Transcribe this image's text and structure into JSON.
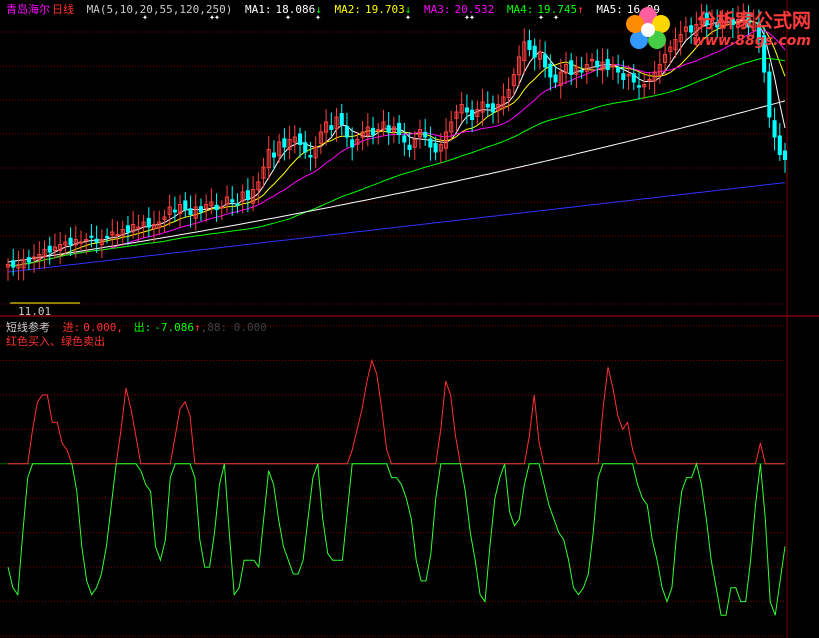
{
  "header": {
    "stock": "青岛海尔",
    "period": "日线",
    "ma_spec": "MA(5,10,20,55,120,250)",
    "ma1": {
      "label": "MA1:",
      "value": "18.086",
      "arrow": "↓",
      "color": "#ffffff"
    },
    "ma2": {
      "label": "MA2:",
      "value": "19.703",
      "arrow": "↓",
      "color": "#ffff00"
    },
    "ma3": {
      "label": "MA3:",
      "value": "20.532",
      "arrow": "",
      "color": "#ff00ff"
    },
    "ma4": {
      "label": "MA4:",
      "value": "19.745",
      "arrow": "↑",
      "color": "#00ff00"
    },
    "ma5": {
      "label": "MA5:",
      "value": "16.99",
      "arrow": "",
      "color": "#ffffff"
    }
  },
  "date_label": "11.01",
  "indicator": {
    "name": "短线参考",
    "in_label": "进:",
    "in_value": "0.000,",
    "out_label": "出:",
    "out_value": "-7.086",
    "out_arrow": "↑",
    "extra": ",88: 0.000",
    "legend": "红色买入、绿色卖出"
  },
  "watermark": {
    "cn": "分析家公式网",
    "url": "www.88gs.com"
  },
  "colors": {
    "up": "#ff4040",
    "down": "#00ffff",
    "ma1": "#ffffff",
    "ma2": "#ffff00",
    "ma3": "#ff00ff",
    "ma4": "#00ff00",
    "ma5": "#ffffff",
    "ma6": "#3030ff",
    "buy": "#ff3030",
    "sell": "#30ff30",
    "grid": "#800000"
  },
  "chart_data": {
    "type": "line",
    "price_axis": [
      12,
      24
    ],
    "closes": [
      13.9,
      13.8,
      13.9,
      14.1,
      14.0,
      14.2,
      14.3,
      14.5,
      14.4,
      14.6,
      14.7,
      14.8,
      14.7,
      14.9,
      14.8,
      14.9,
      15.0,
      14.8,
      14.9,
      15.0,
      15.2,
      15.1,
      15.3,
      15.2,
      15.5,
      15.4,
      15.6,
      15.4,
      15.5,
      15.6,
      15.8,
      16.2,
      16.0,
      16.3,
      16.1,
      15.9,
      16.2,
      16.0,
      16.3,
      16.4,
      16.1,
      16.2,
      16.6,
      16.4,
      16.3,
      16.8,
      16.5,
      16.9,
      17.2,
      17.8,
      18.5,
      18.2,
      18.8,
      18.6,
      18.9,
      19.0,
      18.7,
      18.4,
      18.2,
      18.6,
      19.2,
      19.6,
      19.3,
      19.8,
      19.5,
      19.0,
      18.6,
      18.9,
      19.2,
      19.4,
      19.1,
      19.3,
      19.6,
      19.2,
      19.4,
      19.1,
      18.8,
      18.5,
      18.9,
      19.3,
      19.0,
      18.6,
      18.4,
      18.7,
      19.2,
      19.6,
      20.0,
      20.3,
      20.0,
      19.7,
      20.1,
      20.4,
      20.2,
      20.0,
      20.3,
      20.6,
      20.9,
      21.5,
      22.2,
      22.8,
      22.5,
      22.2,
      22.4,
      21.8,
      21.4,
      21.2,
      21.6,
      21.9,
      21.5,
      21.8,
      21.6,
      21.9,
      22.1,
      21.8,
      22.0,
      21.7,
      21.9,
      21.6,
      21.3,
      21.5,
      21.2,
      21.0,
      21.1,
      21.3,
      21.6,
      21.9,
      22.3,
      22.6,
      22.9,
      23.1,
      23.4,
      23.2,
      23.5,
      23.8,
      23.5,
      23.7,
      23.4,
      23.6,
      23.8,
      23.5,
      23.7,
      23.9,
      23.4,
      23.6,
      22.9,
      21.6,
      19.8,
      19.0,
      18.3,
      18.1
    ],
    "ma_periods": [
      5,
      10,
      20,
      55,
      120,
      250
    ],
    "series": [
      {
        "name": "进",
        "values": [
          0,
          0,
          0,
          0,
          0,
          0,
          0,
          0,
          0,
          0,
          0,
          0,
          0,
          0,
          0,
          0,
          0,
          0,
          0,
          0,
          0,
          0,
          0,
          0,
          0,
          0,
          0,
          0,
          0,
          0,
          0,
          0,
          0,
          0,
          0,
          0,
          0,
          0,
          0,
          0,
          0,
          0,
          0,
          0,
          0,
          0,
          0,
          0,
          0,
          0,
          0,
          0,
          0,
          0,
          0,
          0,
          0,
          0,
          0,
          0,
          0,
          0,
          0,
          0,
          0,
          0,
          0,
          0,
          0,
          0,
          0,
          0,
          0,
          0,
          0,
          0,
          0,
          0,
          0,
          0,
          0,
          0,
          0,
          0,
          0,
          0,
          0,
          0,
          0,
          0,
          0,
          0,
          0,
          0,
          0,
          0,
          0,
          0,
          0,
          0,
          0,
          0,
          0,
          0,
          0,
          0,
          0,
          0,
          0,
          0,
          0,
          0,
          0,
          0,
          0,
          0,
          0,
          0,
          0,
          0,
          0,
          0,
          0,
          0,
          0,
          0,
          0,
          0,
          0,
          0,
          0,
          0,
          0,
          0,
          0,
          0,
          0,
          0,
          0,
          0,
          0,
          0,
          0,
          0,
          0,
          0,
          0,
          0,
          0,
          0,
          0,
          0
        ]
      },
      {
        "name": "出",
        "values": [
          -7.086
        ]
      }
    ],
    "oscillator": [
      -15,
      -18,
      -19,
      -10,
      -2,
      5,
      9,
      10,
      10,
      6,
      6,
      3,
      2,
      0,
      -4,
      -12,
      -17,
      -19,
      -18,
      -16,
      -12,
      -6,
      0,
      5,
      11,
      8,
      4,
      -1,
      -3,
      -4,
      -12,
      -14,
      -11,
      -2,
      4,
      8,
      9,
      7,
      -2,
      -11,
      -15,
      -15,
      -10,
      -3,
      0,
      -10,
      -19,
      -18,
      -14,
      -14,
      -14,
      -15,
      -8,
      -1,
      -3,
      -8,
      -12,
      -14,
      -16,
      -16,
      -14,
      -8,
      -2,
      0,
      -8,
      -13,
      -14,
      -14,
      -14,
      -7,
      2,
      5,
      8,
      12,
      15,
      13,
      8,
      2,
      -2,
      -2,
      -3,
      -5,
      -8,
      -14,
      -17,
      -17,
      -13,
      -5,
      5,
      12,
      10,
      4,
      0,
      -4,
      -10,
      -14,
      -19,
      -20,
      -12,
      -5,
      -2,
      0,
      -7,
      -9,
      -8,
      -3,
      4,
      10,
      3,
      -3,
      -6,
      -8,
      -10,
      -11,
      -14,
      -18,
      -19,
      -18,
      -16,
      -10,
      -2,
      8,
      14,
      11,
      7,
      5,
      6,
      2,
      -3,
      -5,
      -6,
      -11,
      -14,
      -18,
      -20,
      -18,
      -10,
      -4,
      -2,
      -2,
      0,
      -3,
      -8,
      -14,
      -18,
      -22,
      -22,
      -18,
      -18,
      -20,
      -20,
      -14,
      -6,
      3,
      -8,
      -20,
      -22,
      -17,
      -12
    ],
    "osc_ylim": [
      -25,
      20
    ]
  }
}
